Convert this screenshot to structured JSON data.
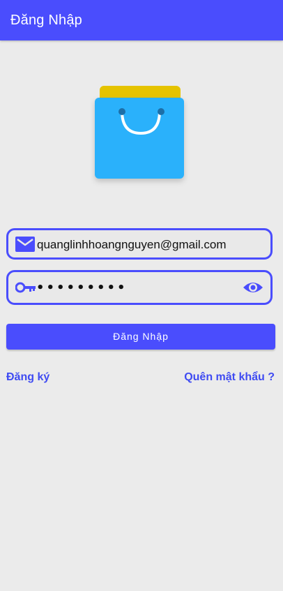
{
  "app_bar": {
    "title": "Đăng Nhập"
  },
  "logo": {
    "icon": "shopping-bag-icon",
    "colors": {
      "bag": "#29B1FB",
      "back": "#E5C300"
    }
  },
  "form": {
    "email": {
      "icon": "email-icon",
      "value": "quanglinhhoangnguyen@gmail.com"
    },
    "password": {
      "icon": "key-icon",
      "value": "•••••••••",
      "visibility_icon": "eye-icon"
    },
    "login_button_label": "Đăng Nhập"
  },
  "links": {
    "register": "Đăng ký",
    "forgot_password": "Quên mật khẩu ?"
  },
  "colors": {
    "primary": "#4A4DFD",
    "background": "#EBEBEB"
  }
}
